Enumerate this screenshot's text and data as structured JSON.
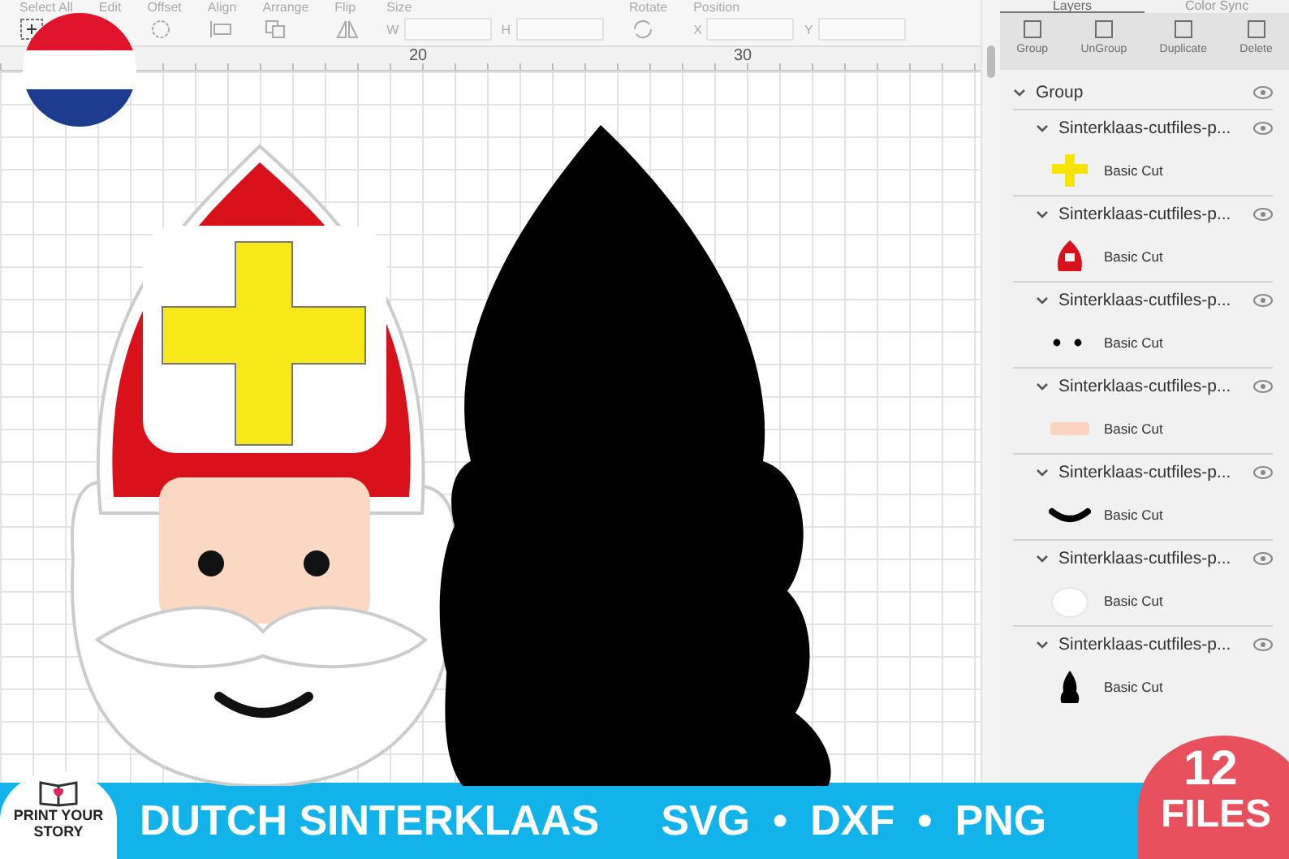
{
  "toolbar": {
    "groups": [
      {
        "label": "Select All",
        "kind": "select"
      },
      {
        "label": "Edit",
        "kind": "edit"
      },
      {
        "label": "Offset",
        "kind": "offset"
      },
      {
        "label": "Align",
        "kind": "align"
      },
      {
        "label": "Arrange",
        "kind": "arrange"
      },
      {
        "label": "Flip",
        "kind": "flip"
      },
      {
        "label": "Size",
        "kind": "size",
        "fields": [
          "W",
          "H"
        ]
      },
      {
        "label": "Rotate",
        "kind": "rotate"
      },
      {
        "label": "Position",
        "kind": "position",
        "fields": [
          "X",
          "Y"
        ]
      }
    ]
  },
  "ruler": {
    "marks": [
      "20",
      "30"
    ]
  },
  "layers_panel": {
    "tabs": [
      {
        "label": "Layers",
        "selected": true
      },
      {
        "label": "Color Sync",
        "selected": false
      }
    ],
    "actions": [
      {
        "label": "Group",
        "disabled": true
      },
      {
        "label": "UnGroup",
        "disabled": true
      },
      {
        "label": "Duplicate",
        "disabled": true
      },
      {
        "label": "Delete",
        "disabled": true
      }
    ],
    "tree": {
      "label": "Group",
      "expanded": true,
      "children": [
        {
          "label": "Sinterklaas-cutfiles-p...",
          "expanded": true,
          "children": [
            {
              "label": "Basic Cut",
              "kind": "cross"
            }
          ]
        },
        {
          "label": "Sinterklaas-cutfiles-p...",
          "expanded": true,
          "children": [
            {
              "label": "Basic Cut",
              "kind": "hat"
            }
          ]
        },
        {
          "label": "Sinterklaas-cutfiles-p...",
          "expanded": true,
          "children": [
            {
              "label": "Basic Cut",
              "kind": "eyes"
            }
          ]
        },
        {
          "label": "Sinterklaas-cutfiles-p...",
          "expanded": true,
          "children": [
            {
              "label": "Basic Cut",
              "kind": "face"
            }
          ]
        },
        {
          "label": "Sinterklaas-cutfiles-p...",
          "expanded": true,
          "children": [
            {
              "label": "Basic Cut",
              "kind": "mouth"
            }
          ]
        },
        {
          "label": "Sinterklaas-cutfiles-p...",
          "expanded": true,
          "children": [
            {
              "label": "Basic Cut",
              "kind": "beard"
            }
          ]
        },
        {
          "label": "Sinterklaas-cutfiles-p...",
          "expanded": true,
          "children": [
            {
              "label": "Basic Cut",
              "kind": "silhouette"
            }
          ]
        }
      ]
    }
  },
  "banner": {
    "logo": "PRINT YOUR STORY",
    "title": "DUTCH SINTERKLAAS",
    "formats": [
      "SVG",
      "DXF",
      "PNG"
    ],
    "separator": "•",
    "count": "12",
    "count_label": "FILES"
  }
}
